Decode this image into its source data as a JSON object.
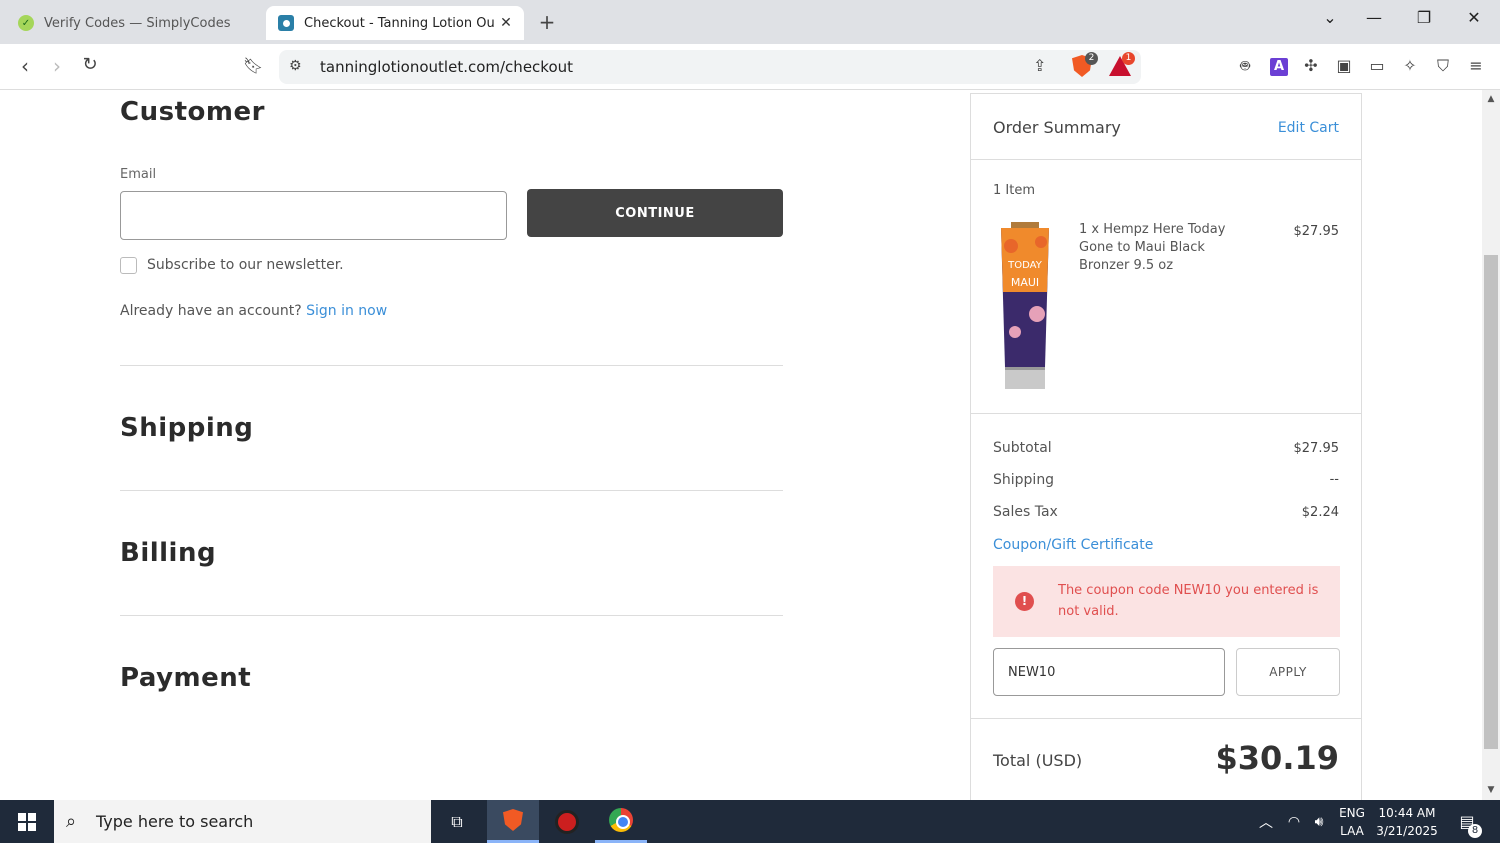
{
  "browser": {
    "tabs": [
      {
        "title": "Verify Codes — SimplyCodes",
        "active": false
      },
      {
        "title": "Checkout - Tanning Lotion Outl",
        "active": true
      }
    ],
    "url": "tanninglotionoutlet.com/checkout",
    "shield_badge": "2",
    "rewards_badge": "1"
  },
  "checkout": {
    "customer_title": "Customer",
    "email_label": "Email",
    "email_value": "",
    "continue_label": "CONTINUE",
    "newsletter_label": "Subscribe to our newsletter.",
    "newsletter_checked": false,
    "account_prompt": "Already have an account?",
    "sign_in_link": "Sign in now",
    "shipping_title": "Shipping",
    "billing_title": "Billing",
    "payment_title": "Payment"
  },
  "summary": {
    "title": "Order Summary",
    "edit_cart": "Edit Cart",
    "item_count": "1 Item",
    "item": {
      "name": "1 x Hempz Here Today Gone to Maui Black Bronzer 9.5 oz",
      "price": "$27.95",
      "image_text": [
        "TODAY",
        "MAUI"
      ]
    },
    "subtotal_label": "Subtotal",
    "subtotal_value": "$27.95",
    "shipping_label": "Shipping",
    "shipping_value": "--",
    "tax_label": "Sales Tax",
    "tax_value": "$2.24",
    "coupon_link": "Coupon/Gift Certificate",
    "error_message": "The coupon code NEW10 you entered is not valid.",
    "coupon_value": "NEW10",
    "apply_label": "APPLY",
    "total_label": "Total (USD)",
    "total_value": "$30.19"
  },
  "taskbar": {
    "search_placeholder": "Type here to search",
    "language": "ENG",
    "layout": "LAA",
    "time": "10:44 AM",
    "date": "3/21/2025",
    "notifications": "8"
  },
  "colors": {
    "accent_link": "#3b8fd8",
    "button_dark": "#444444",
    "error_bg": "#fbe3e3",
    "error_text": "#e04f4f"
  }
}
